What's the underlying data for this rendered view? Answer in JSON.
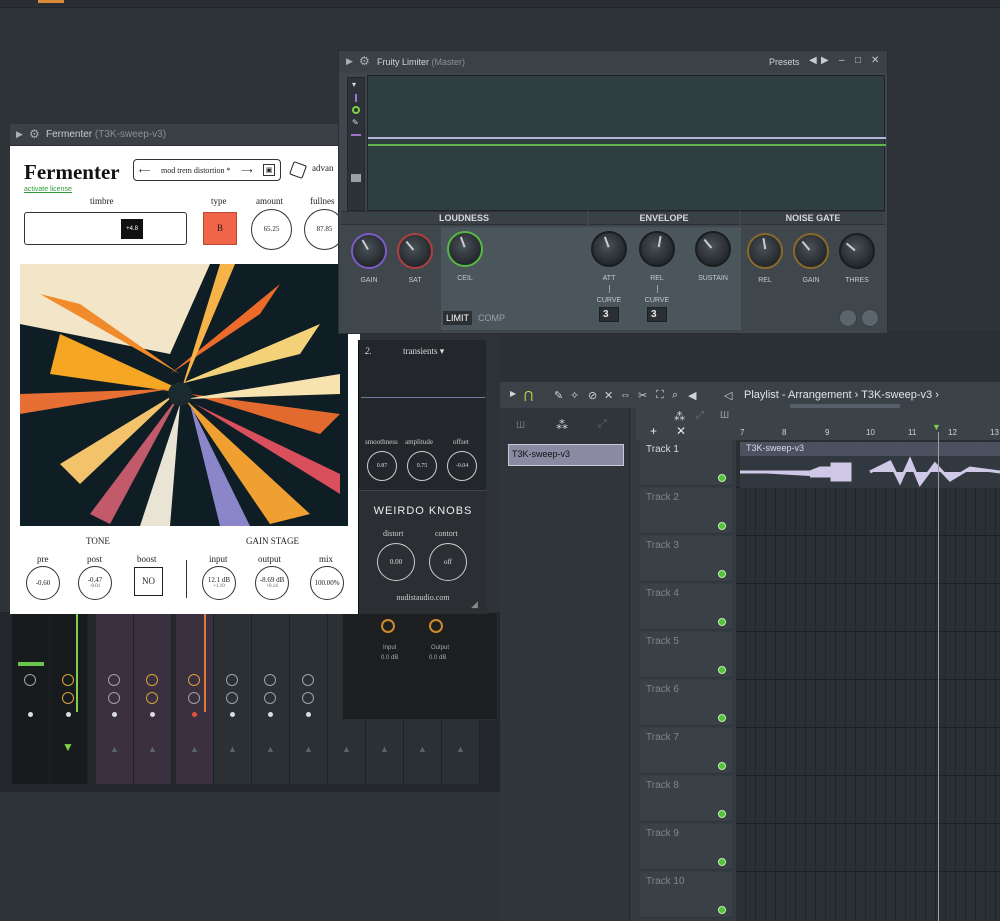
{
  "limiter": {
    "title": "Fruity Limiter",
    "subtitle": "(Master)",
    "presets_label": "Presets",
    "sections": [
      "LOUDNESS",
      "ENVELOPE",
      "NOISE GATE"
    ],
    "loudness_knobs": [
      "GAIN",
      "SAT"
    ],
    "ceil_label": "CEIL",
    "envelope_knobs": [
      "ATT",
      "REL",
      "SUSTAIN"
    ],
    "curve_label": "CURVE",
    "att_curve": "3",
    "rel_curve": "3",
    "gate_knobs": [
      "REL",
      "GAIN",
      "THRES"
    ],
    "mode_limit": "LIMIT",
    "mode_comp": "COMP"
  },
  "fermenter": {
    "title": "Fermenter",
    "subtitle": "(T3K-sweep-v3)",
    "logo": "Fermenter",
    "license_link": "activate license",
    "preset_name": "mod trem distortion *",
    "preset_prev": "⟵",
    "preset_next": "⟶",
    "advanced_label": "advan",
    "timbre_label": "timbre",
    "timbre_value": "+4.8",
    "type_label": "type",
    "type_value": "B",
    "amount_label": "amount",
    "amount_value": "65.25",
    "fullness_label": "fullnes",
    "fullness_value": "87.85",
    "tone_label": "TONE",
    "gain_stage_label": "GAIN STAGE",
    "pre_label": "pre",
    "pre_value": "-0.60",
    "post_label": "post",
    "post_value": "-0.47",
    "post_sub": "-0.01",
    "boost_label": "boost",
    "boost_value": "NO",
    "input_label": "input",
    "input_value": "12.1 dB",
    "input_sub": "+1.19",
    "output_label": "output",
    "output_value": "-8.69 dB",
    "output_sub": "+0.14",
    "mix_label": "mix",
    "mix_value": "100.00%",
    "panel_number": "2.",
    "panel_select": "transients ▾",
    "smoothness_label": "smoothness",
    "smoothness_value": "0.87",
    "amplitude_label": "amplitude",
    "amplitude_value": "0.75",
    "offset_label": "offset",
    "offset_value": "-0.04",
    "weirdo_title": "WEIRDO KNOBS",
    "distort_label": "distort",
    "distort_value": "0.00",
    "contort_label": "contort",
    "contort_value": "off",
    "website": "nudistaudio.com"
  },
  "mixer": {
    "fx_input_label": "Input",
    "fx_output_label": "Output",
    "fx_input_value": "0.0 dB",
    "fx_output_value": "0.0 dB"
  },
  "playlist": {
    "title": "Playlist - Arrangement",
    "crumb_sep": "›",
    "pattern_name": "T3K-sweep-v3",
    "clip_name": "T3K-sweep-v3",
    "ruler": [
      "7",
      "8",
      "9",
      "10",
      "11",
      "12",
      "13"
    ],
    "tracks": [
      "Track 1",
      "Track 2",
      "Track 3",
      "Track 4",
      "Track 5",
      "Track 6",
      "Track 7",
      "Track 8",
      "Track 9",
      "Track 10"
    ]
  }
}
